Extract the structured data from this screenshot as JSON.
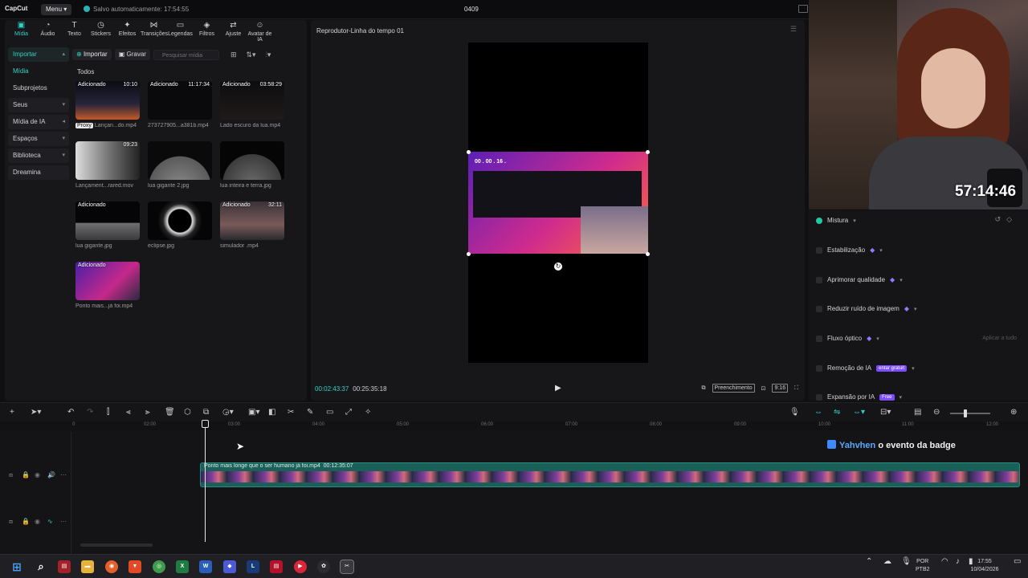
{
  "app": {
    "logo": "CapCut",
    "menu": "Menu",
    "autosave": "Salvo automaticamente: 17:54:55",
    "project": "0409"
  },
  "toolbar": [
    {
      "label": "Mídia",
      "icon": "media-icon",
      "glyph": "▣",
      "active": true
    },
    {
      "label": "Áudio",
      "icon": "audio-icon",
      "glyph": "◔"
    },
    {
      "label": "Texto",
      "icon": "text-icon",
      "glyph": "T"
    },
    {
      "label": "Stickers",
      "icon": "sticker-icon",
      "glyph": "◷"
    },
    {
      "label": "Efeitos",
      "icon": "effects-icon",
      "glyph": "✦"
    },
    {
      "label": "Transições",
      "icon": "transition-icon",
      "glyph": "⋈"
    },
    {
      "label": "Legendas",
      "icon": "captions-icon",
      "glyph": "▭"
    },
    {
      "label": "Filtros",
      "icon": "filter-icon",
      "glyph": "◈"
    },
    {
      "label": "Ajuste",
      "icon": "adjust-icon",
      "glyph": "⇄"
    },
    {
      "label": "Avatar de IA",
      "icon": "avatar-icon",
      "glyph": "☺"
    }
  ],
  "sidebar": [
    {
      "label": "Importar",
      "style": "hi",
      "chev": "▴"
    },
    {
      "label": "Mídia",
      "style": "plain-hi"
    },
    {
      "label": "Subprojetos",
      "style": "plain"
    },
    {
      "label": "Seus",
      "chev": "▾"
    },
    {
      "label": "Mídia de IA",
      "chev": "◂"
    },
    {
      "label": "Espaços",
      "chev": "▾"
    },
    {
      "label": "Biblioteca",
      "chev": "▾"
    },
    {
      "label": "Dreamina"
    }
  ],
  "media_bar": {
    "import": "Importar",
    "record": "Gravar",
    "search_placeholder": "Pesquisar mídia",
    "all": "Todos"
  },
  "media": [
    {
      "tag": "Adicionado",
      "dur": "10:10",
      "name": "Lançan...do.mp4",
      "proxy": "Proxy",
      "bg": "linear-gradient(180deg,#0b0b14,#27253a 60%,#c45a2a)"
    },
    {
      "tag": "Adicionado",
      "dur": "11:17:34",
      "name": "273727905...a381b.mp4",
      "bg": "#0a0a0c"
    },
    {
      "tag": "Adicionado",
      "dur": "03:58:29",
      "name": "Lado escuro da lua.mp4",
      "bg": "linear-gradient(180deg,#0d0d0f,#1f1a1a)"
    },
    {
      "tag": "",
      "dur": "09:23",
      "name": "Lançament...rared.mov",
      "bg": "linear-gradient(90deg,#ddd,#777 50%,#222)"
    },
    {
      "tag": "",
      "dur": "",
      "name": "lua gigante 2.jpg",
      "bg": "radial-gradient(circle at 50% 120%,#8a8a8a 0,#5a5a5a 55%,#0a0a0a 56%)"
    },
    {
      "tag": "",
      "dur": "",
      "name": "lua inteira e terra.jpg",
      "bg": "radial-gradient(circle at 50% 110%,#6a6a6a 0,#3c3c3c 55%,#050505 56%)"
    },
    {
      "tag": "Adicionado",
      "dur": "",
      "name": "lua gigante.jpg",
      "bg": "linear-gradient(180deg,#050507 55%,#6f6f6f 56%,#3a3a3a)"
    },
    {
      "tag": "",
      "dur": "",
      "name": "eclipse.jpg",
      "bg": "radial-gradient(circle,#000 0,#000 30%,#ddd 33%,#222 45%,#050505 60%)"
    },
    {
      "tag": "Adicionado",
      "dur": "32:11",
      "name": "simulador .mp4",
      "bg": "linear-gradient(180deg,#3a3238,#7a5a5a 60%,#2a2a2e)"
    },
    {
      "tag": "Adicionado",
      "dur": "",
      "name": "Ponto mais...já foi.mp4",
      "bg": "linear-gradient(135deg,#4a1fa8,#c5298a 60%,#2a2a40)"
    }
  ],
  "player": {
    "title": "Reprodutor-Linha do tempo 01",
    "current": "00:02:43:37",
    "total": "00:25:35:18",
    "fill": "Preenchimento",
    "ratio": "9:16",
    "banner": "00 . 00 . 16 ."
  },
  "properties": [
    {
      "label": "Mistura",
      "on": true
    },
    {
      "label": "Estabilização",
      "gem": true
    },
    {
      "label": "Aprimorar qualidade",
      "gem": true
    },
    {
      "label": "Reduzir ruído de imagem",
      "gem": true
    },
    {
      "label": "Fluxo óptico",
      "gem": true,
      "apply": "Aplicar a tudo"
    },
    {
      "label": "Remoção de IA",
      "badge": "entar gratuit"
    },
    {
      "label": "Expansão por IA",
      "badge": "Free"
    }
  ],
  "timer": "57:14:46",
  "ruler": [
    "0",
    "02:00",
    "03:00",
    "04:00",
    "05:00",
    "06:00",
    "07:00",
    "08:00",
    "09:00",
    "10:00",
    "11:00",
    "12:00"
  ],
  "clip": {
    "name": "Ponto mais longe que o ser humano já foi.mp4",
    "duration": "00:12:35:07"
  },
  "alert": {
    "user": "Yahvhen",
    "text": "o evento da badge"
  },
  "taskbar": {
    "lang1": "POR",
    "lang2": "PTB2",
    "time": "17:55",
    "date": "10/04/2026"
  }
}
